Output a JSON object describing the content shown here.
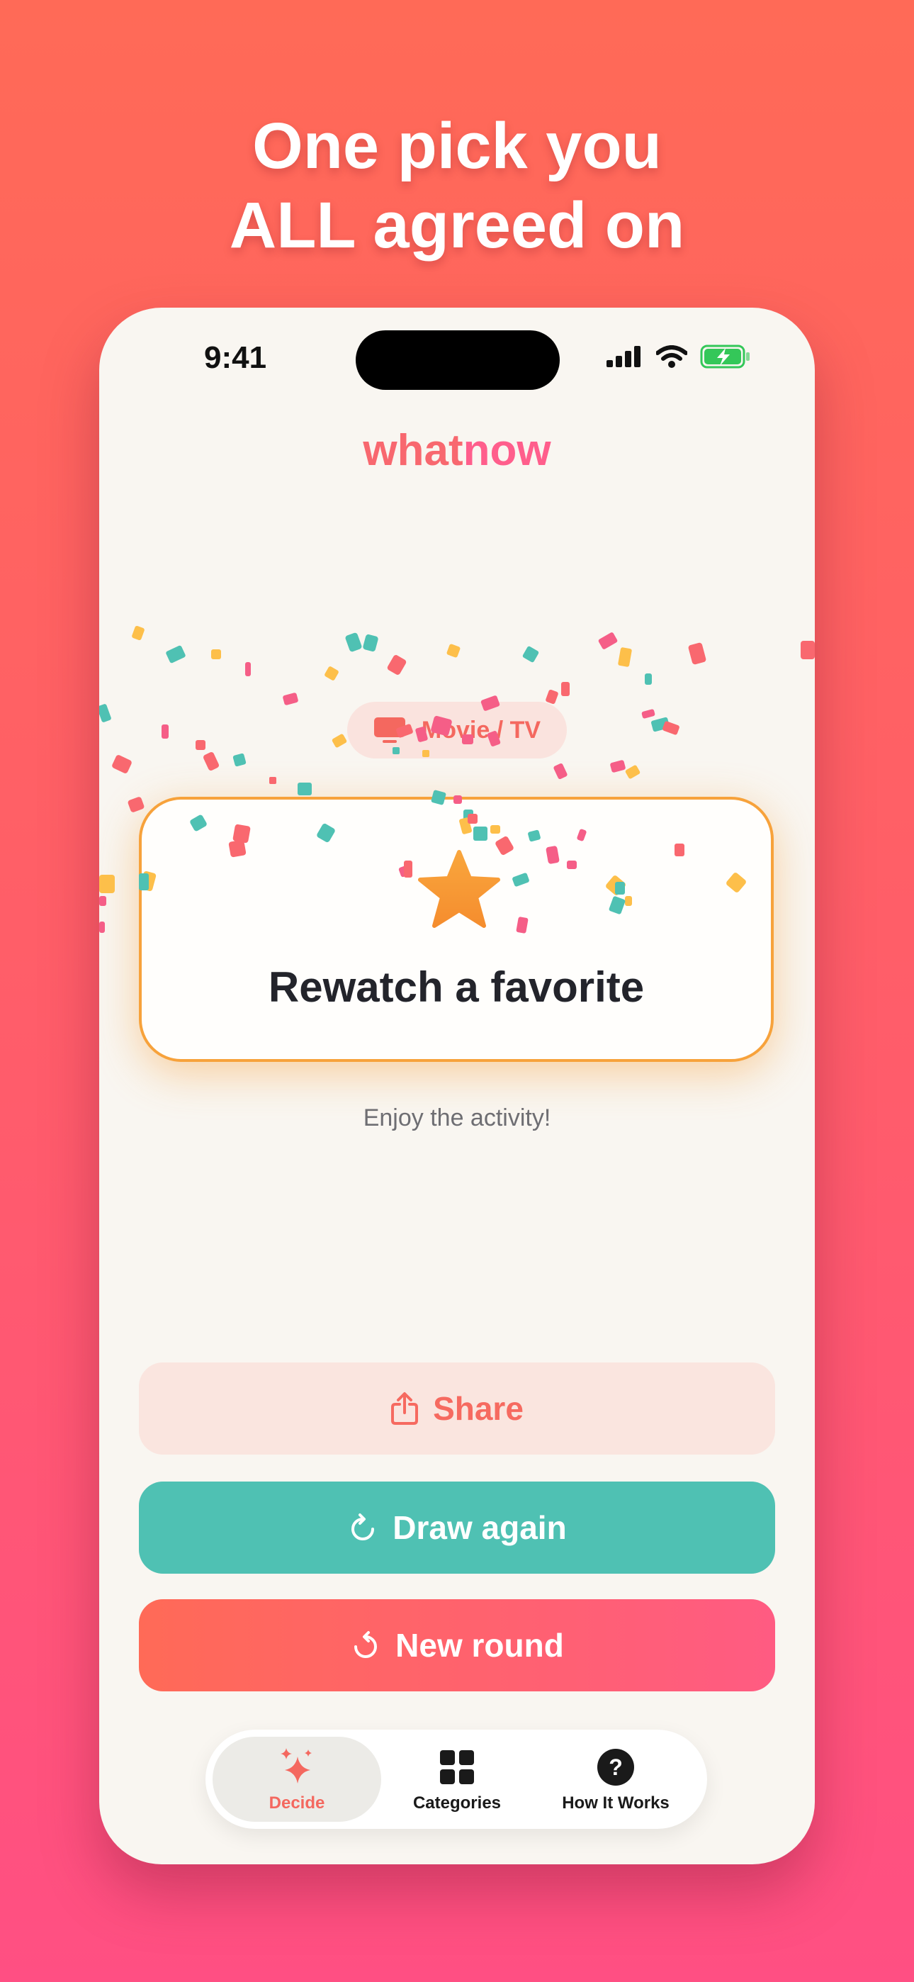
{
  "headline": {
    "line1": "One pick you",
    "line2": "ALL agreed on"
  },
  "status_bar": {
    "time": "9:41"
  },
  "app": {
    "logo_part1": "what",
    "logo_part2": "now"
  },
  "category_chip": {
    "label": "Movie / TV",
    "icon": "tv-icon"
  },
  "result_card": {
    "title": "Rewatch a favorite",
    "icon": "star-icon"
  },
  "subtitle": "Enjoy the activity!",
  "buttons": {
    "share": {
      "label": "Share",
      "icon": "share-icon"
    },
    "draw_again": {
      "label": "Draw again",
      "icon": "refresh-icon"
    },
    "new_round": {
      "label": "New round",
      "icon": "restart-icon"
    }
  },
  "tab_bar": {
    "items": [
      {
        "label": "Decide",
        "icon": "sparkles-icon",
        "selected": true
      },
      {
        "label": "Categories",
        "icon": "grid-icon",
        "selected": false
      },
      {
        "label": "How It Works",
        "icon": "question-icon",
        "selected": false
      }
    ]
  },
  "colors": {
    "coral": "#F4685F",
    "teal": "#4FC1B3",
    "pink": "#FF5B82",
    "orange": "#F7A23B",
    "background": "#F9F6F1"
  }
}
